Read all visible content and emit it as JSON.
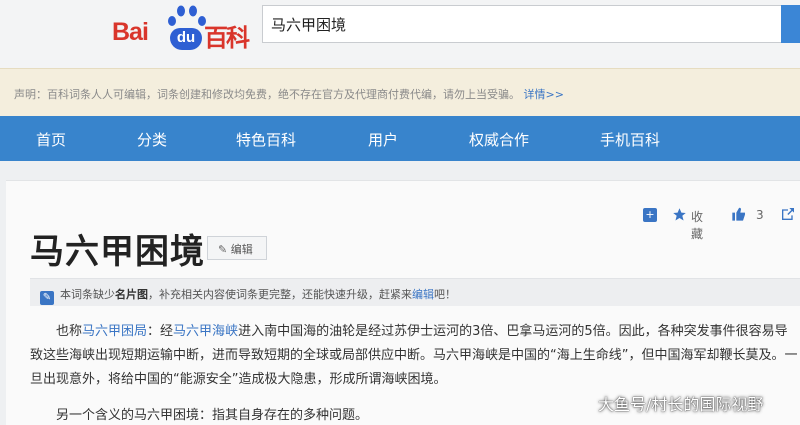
{
  "header": {
    "logo_bai": "Bai",
    "logo_du": "du",
    "logo_baike": "百科",
    "search_value": "马六甲困境"
  },
  "notice": {
    "text": "声明：百科词条人人可编辑，词条创建和修改均免费，绝不存在官方及代理商付费代编，请勿上当受骗。",
    "more": "详情>>"
  },
  "nav": {
    "items": [
      "首页",
      "分类",
      "特色百科",
      "用户",
      "权威合作",
      "手机百科"
    ]
  },
  "tools": {
    "favorite": "收藏",
    "like_count": "3"
  },
  "article": {
    "title": "马六甲困境",
    "edit_label": "编辑",
    "tip": {
      "t1": "本词条缺少",
      "b1": "名片图",
      "t2": "，补充相关内容使词条更完整，还能快速升级，赶紧来",
      "link": "编辑",
      "t3": "吧！"
    },
    "para1": {
      "s1": "也称",
      "l1": "马六甲困局",
      "s2": "：经",
      "l2": "马六甲海峡",
      "s3": "进入南中国海的油轮是经过苏伊士运河的3倍、巴拿马运河的5倍。因此，各种突发事件很容易导致这些海峡出现短期运输中断，进而导致短期的全球或局部供应中断。马六甲海峡是中国的“海上生命线”，但中国海军却鞭长莫及。一旦出现意外，将给中国的“能源安全”造成极大隐患，形成所谓海峡困境。"
    },
    "para2": "另一个含义的马六甲困境：指其自身存在的多种问题。"
  },
  "watermark": "大鱼号/村长的国际视野"
}
